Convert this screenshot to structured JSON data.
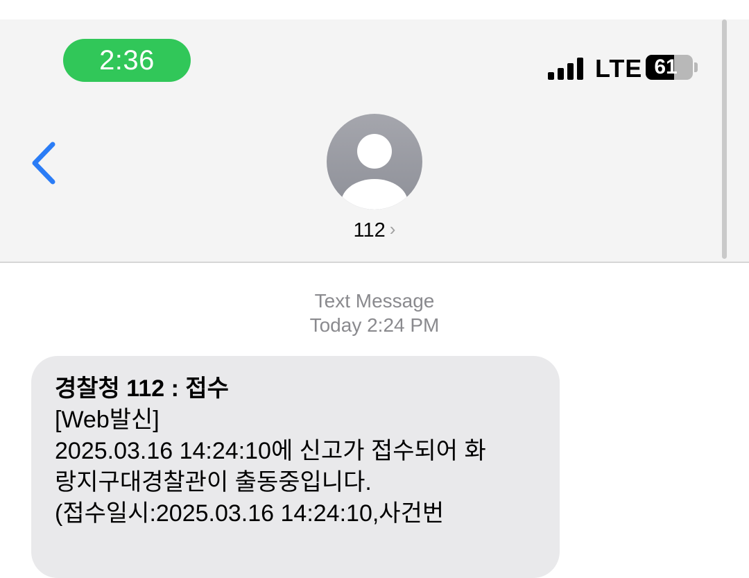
{
  "status_bar": {
    "time": "2:36",
    "network": "LTE",
    "battery": "61",
    "battery_level": 0.61,
    "time_pill_color": "#31c759"
  },
  "header": {
    "back_icon": "chevron-left-icon",
    "contact_icon": "person-silhouette-icon",
    "contact_name": "112",
    "contact_chevron": "›",
    "accent_color": "#2a7cf6"
  },
  "thread": {
    "message_type": "Text Message",
    "timestamp": "Today 2:24 PM",
    "message": {
      "lines": [
        "경찰청 112 : 접수",
        "[Web발신]",
        "2025.03.16 14:24:10에 신고가 접수되어 화",
        "랑지구대경찰관이 출동중입니다.",
        "(접수일시:2025.03.16 14:24:10,사건번"
      ]
    }
  }
}
